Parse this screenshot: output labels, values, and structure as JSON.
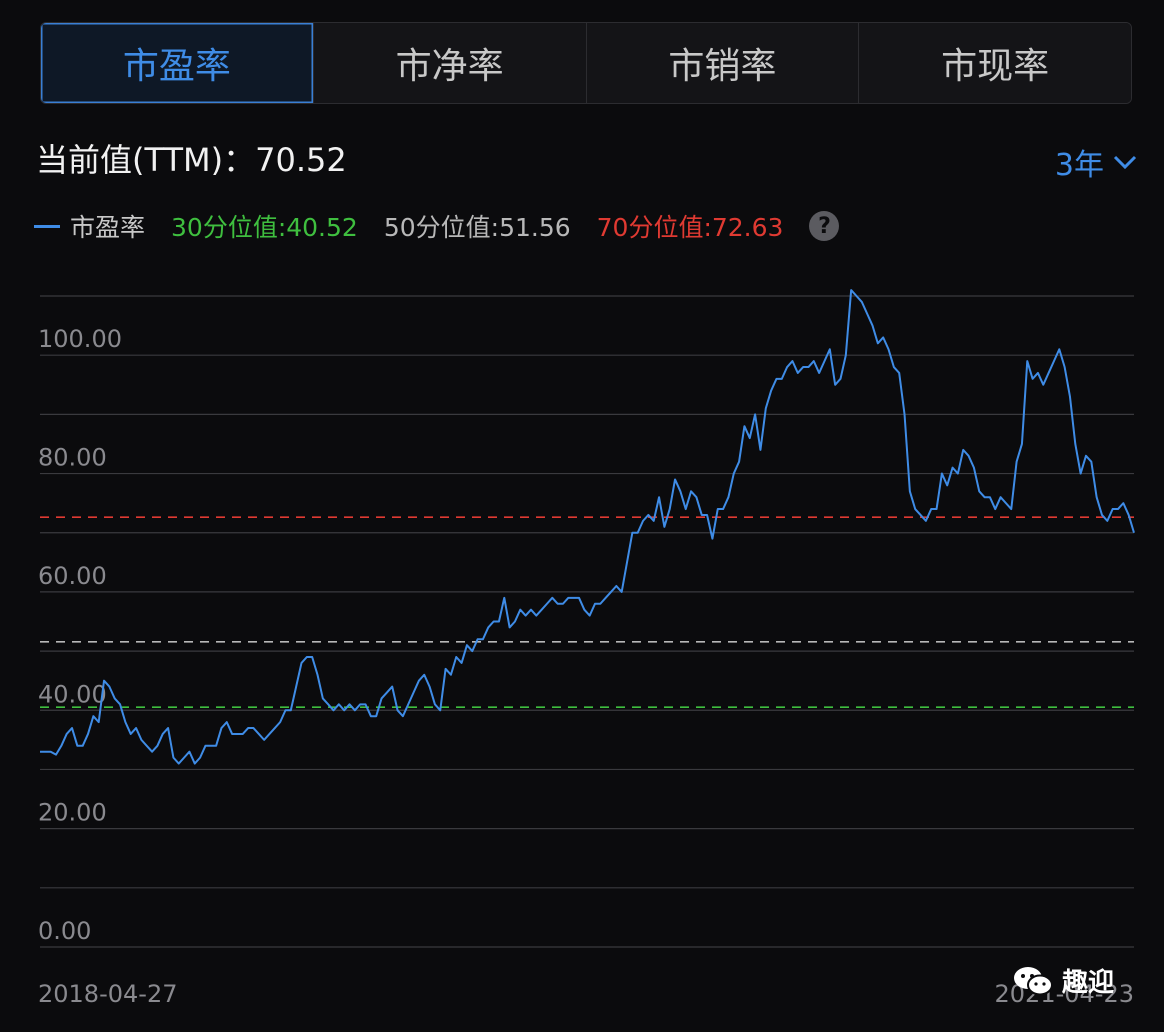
{
  "tabs": [
    {
      "label": "市盈率",
      "active": true
    },
    {
      "label": "市净率",
      "active": false
    },
    {
      "label": "市销率",
      "active": false
    },
    {
      "label": "市现率",
      "active": false
    }
  ],
  "current_label": "当前值(TTM)：70.52",
  "range_label": "3年",
  "legend": {
    "series_label": "市盈率",
    "p30_label": "30分位值:40.52",
    "p50_label": "50分位值:51.56",
    "p70_label": "70分位值:72.63"
  },
  "colors": {
    "series": "#3f8ce6",
    "p30": "#3fbf3f",
    "p50": "#b8b8b8",
    "p70": "#e03a32",
    "grid": "#3a3a3e"
  },
  "watermark": {
    "text": "趣迎",
    "icon": "wechat-icon"
  },
  "chart_data": {
    "type": "line",
    "title": "",
    "xlabel": "",
    "ylabel": "",
    "ylim": [
      0,
      110
    ],
    "yticks": [
      0,
      20,
      40,
      60,
      80,
      100
    ],
    "ytick_labels": [
      "0.00",
      "20.00",
      "40.00",
      "60.00",
      "80.00",
      "100.00"
    ],
    "x_start_label": "2018-04-27",
    "x_end_label": "2021-04-23",
    "grid": true,
    "reference_lines": [
      {
        "name": "30分位值",
        "value": 40.52,
        "style": "dashed"
      },
      {
        "name": "50分位值",
        "value": 51.56,
        "style": "dashed"
      },
      {
        "name": "70分位值",
        "value": 72.63,
        "style": "dashed"
      }
    ],
    "series": [
      {
        "name": "市盈率",
        "values": [
          33,
          33,
          33,
          32.5,
          34,
          36,
          37,
          34,
          34,
          36,
          39,
          38,
          45,
          44,
          42,
          41,
          38,
          36,
          37,
          35,
          34,
          33,
          34,
          36,
          37,
          32,
          31,
          32,
          33,
          31,
          32,
          34,
          34,
          34,
          37,
          38,
          36,
          36,
          36,
          37,
          37,
          36,
          35,
          36,
          37,
          38,
          40,
          40,
          44,
          48,
          49,
          49,
          46,
          42,
          41,
          40,
          41,
          40,
          41,
          40,
          41,
          41,
          39,
          39,
          42,
          43,
          44,
          40,
          39,
          41,
          43,
          45,
          46,
          44,
          41,
          40,
          47,
          46,
          49,
          48,
          51,
          50,
          52,
          52,
          54,
          55,
          55,
          59,
          54,
          55,
          57,
          56,
          57,
          56,
          57,
          58,
          59,
          58,
          58,
          59,
          59,
          59,
          57,
          56,
          58,
          58,
          59,
          60,
          61,
          60,
          65,
          70,
          70,
          72,
          73,
          72,
          76,
          71,
          74,
          79,
          77,
          74,
          77,
          76,
          73,
          73,
          69,
          74,
          74,
          76,
          80,
          82,
          88,
          86,
          90,
          84,
          91,
          94,
          96,
          96,
          98,
          99,
          97,
          98,
          98,
          99,
          97,
          99,
          101,
          95,
          96,
          100,
          111,
          110,
          109,
          107,
          105,
          102,
          103,
          101,
          98,
          97,
          90,
          77,
          74,
          73,
          72,
          74,
          74,
          80,
          78,
          81,
          80,
          84,
          83,
          81,
          77,
          76,
          76,
          74,
          76,
          75,
          74,
          82,
          85,
          99,
          96,
          97,
          95,
          97,
          99,
          101,
          98,
          93,
          85,
          80,
          83,
          82,
          76,
          73,
          72,
          74,
          74,
          75,
          73,
          70
        ]
      }
    ]
  }
}
